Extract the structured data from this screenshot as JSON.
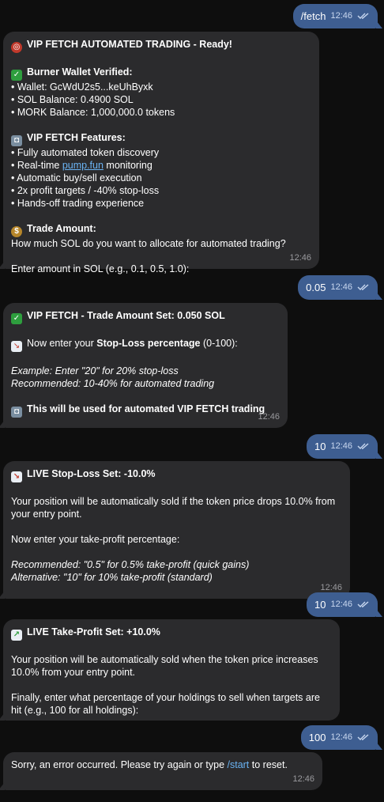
{
  "messages": {
    "m1": {
      "text": "/fetch",
      "time": "12:46"
    },
    "m2": {
      "title": "VIP FETCH AUTOMATED TRADING - Ready!",
      "wallet_head": "Burner Wallet Verified:",
      "wallet": "• Wallet: GcWdU2s5...keUhByxk",
      "sol": "• SOL Balance: 0.4900 SOL",
      "mork": "• MORK Balance: 1,000,000.0 tokens",
      "features_head": "VIP FETCH Features:",
      "f1": "• Fully automated token discovery",
      "f2_pre": "• Real-time ",
      "f2_link": "pump.fun",
      "f2_post": " monitoring",
      "f3": "• Automatic buy/sell execution",
      "f4": "• 2x profit targets / -40% stop-loss",
      "f5": "• Hands-off trading experience",
      "trade_head": "Trade Amount:",
      "question": "How much SOL do you want to allocate for automated trading?",
      "enter": "Enter amount in SOL (e.g., 0.1, 0.5, 1.0):",
      "time": "12:46"
    },
    "m3": {
      "text": "0.05",
      "time": "12:46"
    },
    "m4": {
      "title": "VIP FETCH - Trade Amount Set: 0.050 SOL",
      "now_pre": "Now enter your ",
      "now_bold": "Stop-Loss percentage",
      "now_post": " (0-100):",
      "example": "Example: Enter \"20\" for 20% stop-loss",
      "recommended": "Recommended: 10-40% for automated trading",
      "used": "This will be used for automated VIP FETCH trading",
      "time": "12:46"
    },
    "m5": {
      "text": "10",
      "time": "12:46"
    },
    "m6": {
      "title": "LIVE Stop-Loss Set: -10.0%",
      "body1": "Your position will be automatically sold if the token price drops 10.0% from your entry point.",
      "body2": "Now enter your take-profit percentage:",
      "rec": "Recommended: \"0.5\" for 0.5% take-profit (quick gains)",
      "alt": "Alternative: \"10\" for 10% take-profit (standard)",
      "time": "12:46"
    },
    "m7": {
      "text": "10",
      "time": "12:46"
    },
    "m8": {
      "title": "LIVE Take-Profit Set: +10.0%",
      "body1": "Your position will be automatically sold when the token price increases 10.0% from your entry point.",
      "body2": "Finally, enter what percentage of your holdings to sell when targets are hit (e.g., 100 for all holdings):",
      "time": "12:46"
    },
    "m9": {
      "text": "100",
      "time": "12:46"
    },
    "m10": {
      "pre": "Sorry, an error occurred. Please try again or type ",
      "link": "/start",
      "post": " to reset.",
      "time": "12:46"
    }
  },
  "icons": {
    "target": "direct-hit-emoji",
    "check": "check-mark-emoji",
    "robot": "robot-emoji",
    "moneybag": "money-bag-emoji",
    "chart_down": "chart-decreasing-emoji",
    "chart_up": "chart-increasing-emoji",
    "read_ticks": "double-check-icon"
  },
  "colors": {
    "background": "#0e0e0e",
    "outgoing": "#3e5e91",
    "incoming": "#2b2b2d",
    "link": "#6ab3f3"
  }
}
